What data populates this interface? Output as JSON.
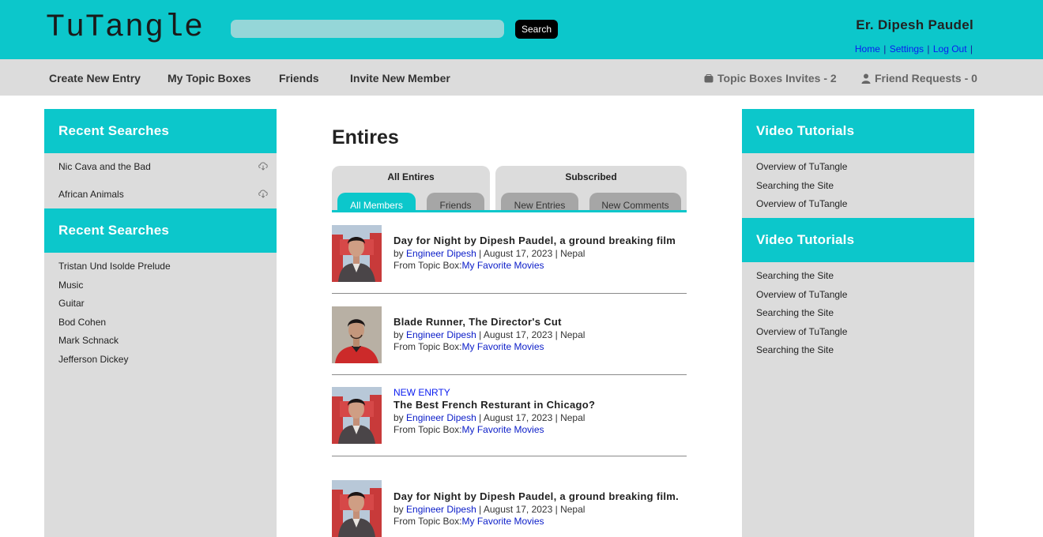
{
  "app": {
    "logo": "TuTangle",
    "search_placeholder": "",
    "search_button": "Search",
    "user_name": "Er. Dipesh Paudel",
    "user_links": [
      "Home",
      "Settings",
      "Log Out"
    ]
  },
  "nav": {
    "items": [
      "Create New Entry",
      "My Topic Boxes",
      "Friends",
      "Invite New Member"
    ],
    "topic_invites": "Topic Boxes Invites - 2",
    "friend_requests": "Friend Requests - 0"
  },
  "left_sidebar": {
    "section1_title": "Recent Searches",
    "section1_items": [
      "Nic Cava and the Bad",
      "African Animals"
    ],
    "section2_title": "Recent Searches",
    "section2_items": [
      "Tristan Und Isolde Prelude",
      "Music",
      "Guitar",
      "Bod Cohen",
      "Mark Schnack",
      "Jefferson Dickey"
    ]
  },
  "right_sidebar": {
    "section1_title": "Video Tutorials",
    "section1_items": [
      "Overview of TuTangle",
      "Searching the Site",
      "Overview of TuTangle"
    ],
    "section2_title": "Video Tutorials",
    "section2_items": [
      "Searching the Site",
      "Overview of TuTangle",
      "Searching the Site",
      "Overview of TuTangle",
      "Searching the Site"
    ]
  },
  "main": {
    "title": "Entires",
    "tab_groups": [
      {
        "label": "All Entires",
        "tabs": [
          "All Members",
          "Friends"
        ],
        "active": 0
      },
      {
        "label": "Subscribed",
        "tabs": [
          "New Entries",
          "New Comments"
        ],
        "active": -1
      }
    ],
    "entries": [
      {
        "badge": "",
        "title": "Day for Night by Dipesh Paudel, a ground breaking film",
        "by": "by ",
        "author": "Engineer Dipesh",
        "date_loc": " | August 17, 2023 | Nepal",
        "from": "From Topic Box:",
        "topic": "My Favorite Movies",
        "photo": "portrait-red-chair"
      },
      {
        "badge": "",
        "title": "Blade Runner, The Director's Cut",
        "by": "by ",
        "author": "Engineer Dipesh",
        "date_loc": " | August 17, 2023 | Nepal",
        "from": "From Topic Box:",
        "topic": "My Favorite Movies",
        "photo": "portrait-red-shirt"
      },
      {
        "badge": "NEW ENRTY",
        "title": "The Best French Resturant in Chicago?",
        "by": "by ",
        "author": "Engineer Dipesh",
        "date_loc": " | August 17, 2023 | Nepal",
        "from": "From Topic Box:",
        "topic": "My Favorite Movies",
        "photo": "portrait-red-chair"
      },
      {
        "badge": "",
        "title": "Day for Night by Dipesh Paudel, a ground breaking film.",
        "by": "by ",
        "author": "Engineer Dipesh",
        "date_loc": " | August 17, 2023 | Nepal",
        "from": "From Topic Box:",
        "topic": "My Favorite Movies",
        "photo": "portrait-red-chair"
      }
    ]
  },
  "colors": {
    "accent": "#0cc7cb",
    "nav_bg": "#dcdcdc",
    "link": "#0a1cf0"
  }
}
